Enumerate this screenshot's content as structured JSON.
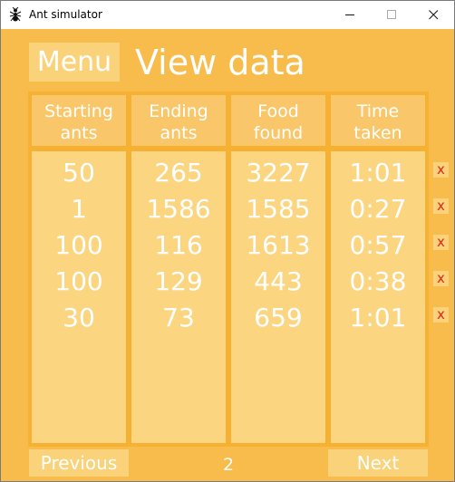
{
  "window": {
    "title": "Ant simulator"
  },
  "header": {
    "menu_label": "Menu",
    "page_title": "View data"
  },
  "table": {
    "columns": [
      {
        "line1": "Starting",
        "line2": "ants"
      },
      {
        "line1": "Ending",
        "line2": "ants"
      },
      {
        "line1": "Food",
        "line2": "found"
      },
      {
        "line1": "Time",
        "line2": "taken"
      }
    ],
    "rows": [
      [
        "50",
        "265",
        "3227",
        "1:01"
      ],
      [
        "1",
        "1586",
        "1585",
        "0:27"
      ],
      [
        "100",
        "116",
        "1613",
        "0:57"
      ],
      [
        "100",
        "129",
        "443",
        "0:38"
      ],
      [
        "30",
        "73",
        "659",
        "1:01"
      ]
    ],
    "delete_label": "x"
  },
  "footer": {
    "previous_label": "Previous",
    "page_number": "2",
    "next_label": "Next"
  },
  "colors": {
    "background": "#f8bc4d",
    "header_cell": "#f9c769",
    "body_cell": "#fbd580",
    "delete_x": "#e0261b"
  }
}
